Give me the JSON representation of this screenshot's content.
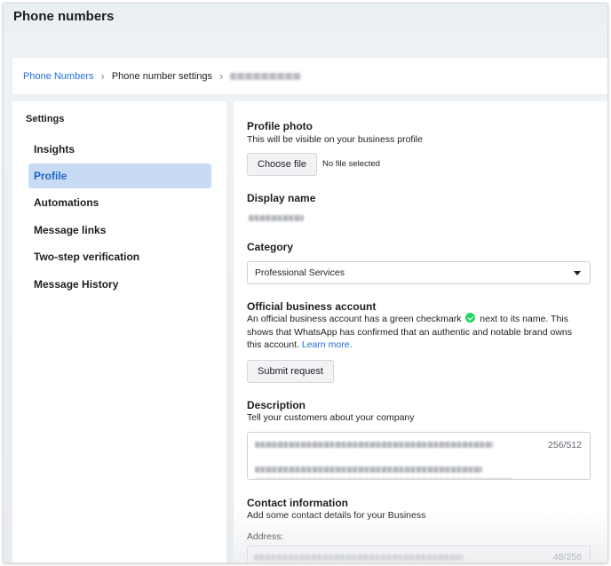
{
  "header": {
    "title": "Phone numbers"
  },
  "breadcrumb": {
    "items": [
      "Phone Numbers",
      "Phone number settings"
    ],
    "separator": "›"
  },
  "sidebar": {
    "heading": "Settings",
    "items": [
      {
        "label": "Insights",
        "active": false
      },
      {
        "label": "Profile",
        "active": true
      },
      {
        "label": "Automations",
        "active": false
      },
      {
        "label": "Message links",
        "active": false
      },
      {
        "label": "Two-step verification",
        "active": false
      },
      {
        "label": "Message History",
        "active": false
      }
    ]
  },
  "profile_photo": {
    "title": "Profile photo",
    "subtitle": "This will be visible on your business profile",
    "button_label": "Choose file",
    "file_status": "No file selected"
  },
  "display_name": {
    "title": "Display name"
  },
  "category": {
    "title": "Category",
    "selected": "Professional Services"
  },
  "official_account": {
    "title": "Official business account",
    "text_before": "An official business account has a green checkmark",
    "text_after": "next to its name. This shows that WhatsApp has confirmed that an authentic and notable brand owns this account.",
    "link": "Learn more.",
    "button_label": "Submit request",
    "icon": "green-checkmark-icon"
  },
  "description": {
    "title": "Description",
    "subtitle": "Tell your customers about your company",
    "counter": "256/512"
  },
  "contact": {
    "title": "Contact information",
    "subtitle": "Add some contact details for your Business",
    "address_label": "Address:",
    "address_counter": "48/256"
  },
  "colors": {
    "accent": "#216fdb",
    "active_bg": "#c7dcf4",
    "whatsapp_green": "#25d366"
  }
}
